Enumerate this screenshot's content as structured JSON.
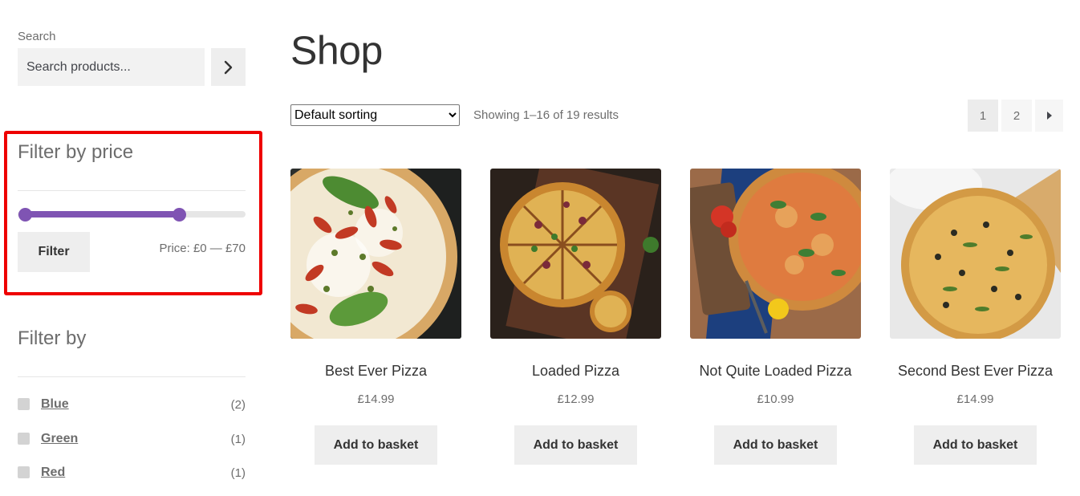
{
  "search": {
    "label": "Search",
    "placeholder": "Search products...",
    "button_icon": "chevron-right-icon"
  },
  "price_filter": {
    "title": "Filter by price",
    "min_value": 0,
    "max_value": 70,
    "range_upper_fraction": 0.72,
    "button_label": "Filter",
    "price_text": "Price: £0 — £70",
    "accent_color": "#7f54b3",
    "highlight_color": "#ee0000"
  },
  "attribute_filter": {
    "title": "Filter by",
    "items": [
      {
        "label": "Blue",
        "count": "(2)"
      },
      {
        "label": "Green",
        "count": "(1)"
      },
      {
        "label": "Red",
        "count": "(1)"
      }
    ]
  },
  "shop": {
    "title": "Shop",
    "sorting_selected": "Default sorting",
    "result_count": "Showing 1–16 of 19 results",
    "pagination": {
      "pages": [
        "1",
        "2"
      ],
      "current": "1",
      "next_icon": "caret-right-icon"
    }
  },
  "products": [
    {
      "name": "Best Ever Pizza",
      "price": "£14.99",
      "button": "Add to basket"
    },
    {
      "name": "Loaded Pizza",
      "price": "£12.99",
      "button": "Add to basket"
    },
    {
      "name": "Not Quite Loaded Pizza",
      "price": "£10.99",
      "button": "Add to basket"
    },
    {
      "name": "Second Best Ever Pizza",
      "price": "£14.99",
      "button": "Add to basket"
    }
  ]
}
